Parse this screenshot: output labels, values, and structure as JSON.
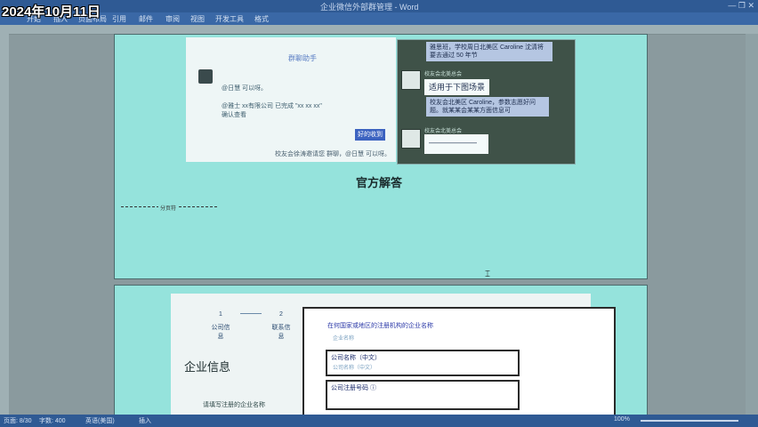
{
  "datestamp": "2024年10月11日",
  "window": {
    "title": "企业微信外部群管理 - Word",
    "controls": "— ❐ ✕"
  },
  "ribbon": {
    "tabs": [
      "开始",
      "插入",
      "页面布局",
      "引用",
      "邮件",
      "审阅",
      "视图",
      "开发工具",
      "格式"
    ]
  },
  "page1": {
    "chat_left": {
      "title": "群聊助手",
      "mention": "@日慧 可以呀。",
      "message": "@雅士 xx有限公司 已完成 \"xx xx xx\" 确认查看",
      "button": "好的收到",
      "footer": "校友会徐涛邀请您 群聊，@日慧 可以呀。"
    },
    "chat_right": {
      "bubble_top": "雅思班，学校周日北美区 Caroline 沈清将要去通过 50 年节",
      "name1": "校友会北美总会",
      "bubble_highlight": "适用于下图场景",
      "bubble_mid": "校友会北美区 Caroline，参数志愿好问题。就某某会某某方面信息可",
      "name2": "校友会北美总会",
      "bubble_bottom": "——————"
    },
    "heading": "官方解答",
    "footnote": "分页符"
  },
  "page2": {
    "steps": [
      {
        "num": "1",
        "label": "公司信息"
      },
      {
        "num": "2",
        "label": "联系信息"
      }
    ],
    "section_title": "企业信息",
    "section_sub": "请填写注册的企业名称",
    "panel": {
      "question": "在何国家或地区的注册机构的企业名称",
      "hint": "企业名称",
      "field1_label": "公司名称（中文）",
      "field1_placeholder": "公司名称（中文）",
      "field2_label": "公司注册号码 ⓘ"
    }
  },
  "status": {
    "page": "页面: 8/30",
    "words": "字数: 400",
    "lang": "英语(美国)",
    "insert": "插入",
    "zoom": "100%"
  }
}
